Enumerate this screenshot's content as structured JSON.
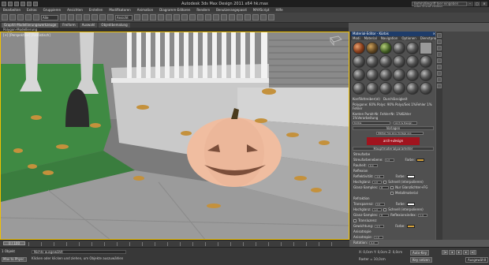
{
  "window": {
    "title": "Autodesk 3ds Max Design 2011 x64    hk.max",
    "search_placeholder": "Befehl/Begriff hier eingeben oder Frage stellen"
  },
  "menu": [
    "Bearbeiten",
    "Extras",
    "Gruppieren",
    "Ansichten",
    "Erstellen",
    "Modifikatoren",
    "Animation",
    "Diagramm-Editoren",
    "Rendern",
    "Benutzerangepasst",
    "MAXScript",
    "Hilfe"
  ],
  "toolbar": {
    "selection_filter": "Alle",
    "view_select": "Ansicht"
  },
  "ribbon": {
    "tabs": [
      "Graphit-Modellierungswerkzeuge",
      "Freiform",
      "Auswahl",
      "Objektbemalung"
    ],
    "active_index": 0,
    "sub_label": "Polygon-Modellierung"
  },
  "viewport": {
    "label": "[+] [Perspektive] [Realistisch]"
  },
  "material_editor": {
    "title": "Material-Editor - Kürbis",
    "menu": [
      "Modi",
      "Material",
      "Navigation",
      "Optionen",
      "Dienstprogramme"
    ],
    "stats": {
      "left_caption": "Konflikttreiber(el)",
      "right_caption": "Durchlässigkeit",
      "row1": "Polygone:  60% Polys:  90% Polys/Sek  1%Fehler  1% Fehler",
      "row2": "Kanten   Punkt-Nr.   Fehler-Nr.   1%Kühler   1%Verarbeitung"
    },
    "material_name": "Kürbis",
    "material_type": "Arch & Design",
    "rollouts": {
      "templates": "Vorlagen",
      "template_select": "Wählen Sie eine Vorlage aus",
      "main_params": "Hauptmaterialparameter"
    },
    "logo_text": "arch+design",
    "diffuse": {
      "header": "Streufarbe",
      "level_label": "Streufarbenebene:",
      "level_value": "1,0",
      "rough_label": "Rauheit:",
      "rough_value": "0,0",
      "color_label": "Farbe:",
      "color": "#d4a13c"
    },
    "reflection": {
      "header": "Reflexion",
      "refl_label": "Reflektivität:",
      "refl_value": "0,6",
      "gloss_label": "Hochglanz:",
      "gloss_value": "1,0",
      "samples_label": "Glanz-Samples:",
      "samples_value": "8",
      "color_label": "Farbe:",
      "check1": "Schnell (interpolieren)",
      "check2": "Nur Glanzlichter+FG",
      "check3": "Metallmaterial"
    },
    "refraction": {
      "header": "Refraktion",
      "trans_label": "Transparenz:",
      "trans_value": "0,0",
      "gloss_label": "Hochglanz:",
      "gloss_value": "1,0",
      "samples_label": "Glanz-Samples:",
      "samples_value": "8",
      "color_label": "Farbe:",
      "check1": "Schnell (interpolieren)",
      "ior_label": "Reflexionsindex:",
      "ior_value": "1,4",
      "translucency_label": "Transluzenz",
      "weight_label": "Gewichtung:",
      "weight_value": "0,5",
      "tcolor_label": "Farbe:"
    },
    "anisotropy": {
      "header": "Anisotropie",
      "aniso_label": "Anisotropie:",
      "aniso_value": "1,0",
      "rot_label": "Rotation:",
      "rot_value": "0,0"
    },
    "tabs": [
      "Verlauf",
      "Ausgabe"
    ]
  },
  "timeline": {
    "frame_slider": "0 / 100"
  },
  "status": {
    "selected": "1 Objekt",
    "script_field": "Nichts ausgewählt",
    "prompt": "Klicken oder klicken und ziehen, um Objekte auszuwählen",
    "coords": "X: 0,0cm   Y: 0,0cm   Z: 0,0cm",
    "grid": "Raster = 10,0cm",
    "autokey": "Auto-Key",
    "setkey": "Key setzen",
    "mini": "Max to Physc",
    "key_filter": "Ausgewählt"
  }
}
